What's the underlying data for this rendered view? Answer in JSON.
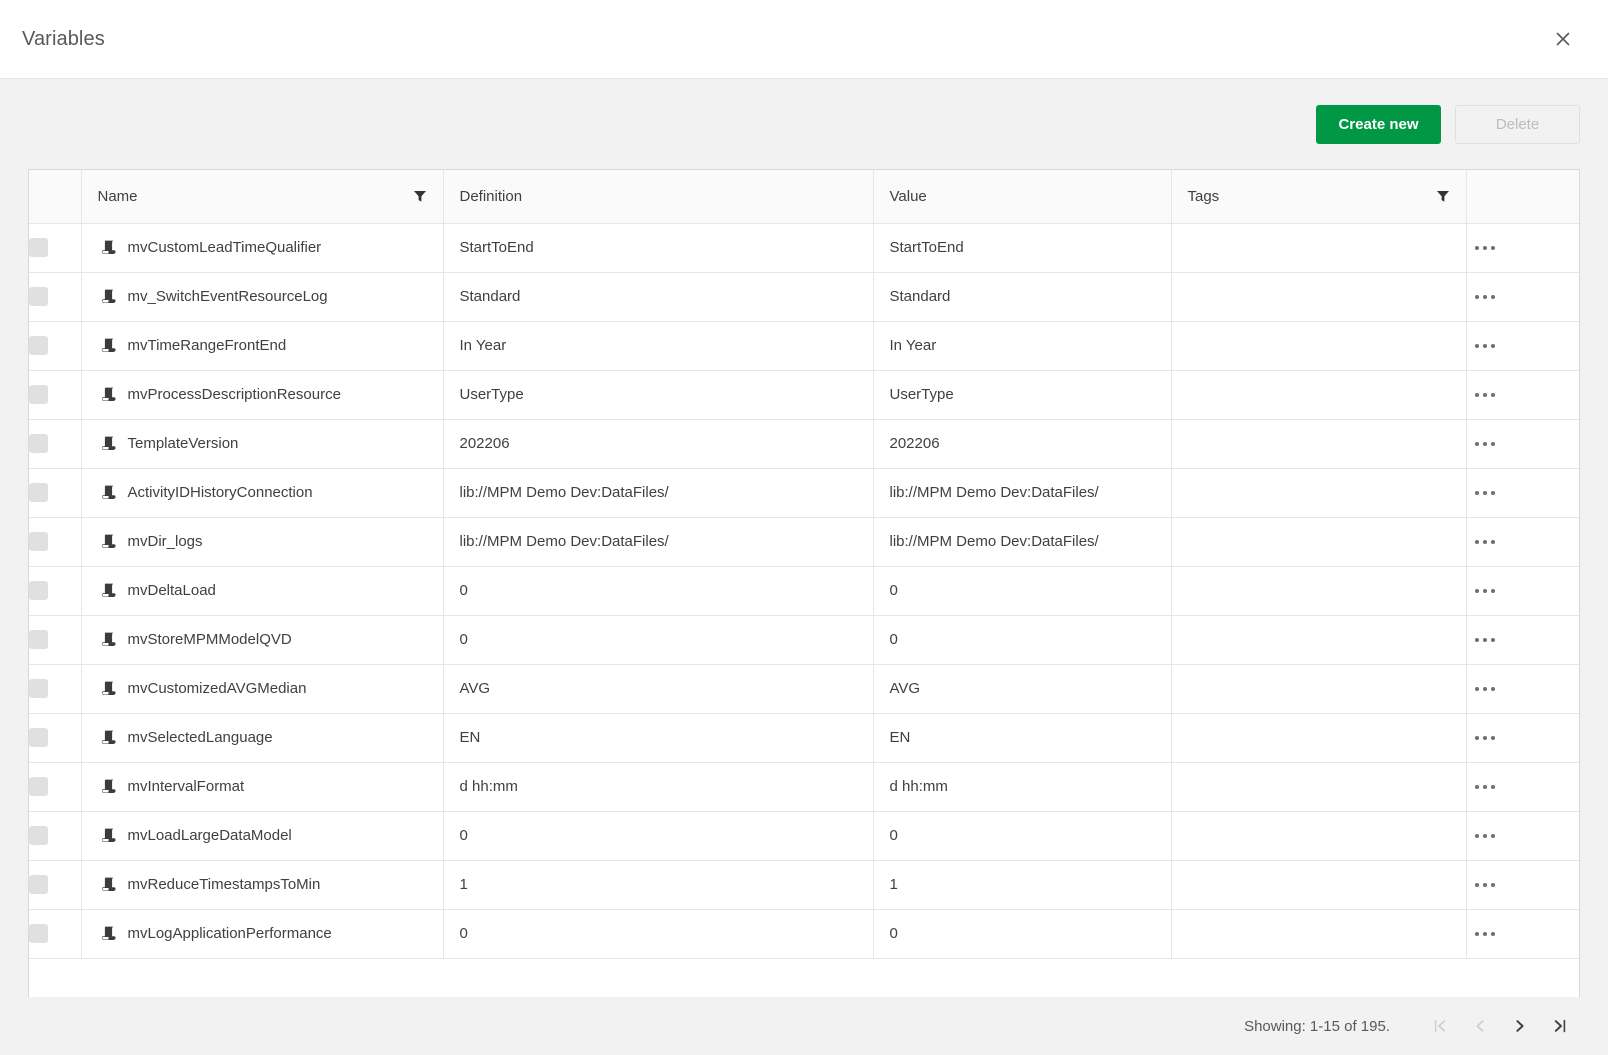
{
  "dialog": {
    "title": "Variables",
    "close_icon": "close-icon"
  },
  "toolbar": {
    "create_label": "Create new",
    "delete_label": "Delete",
    "primary_color": "#009845"
  },
  "table": {
    "columns": [
      {
        "key": "check",
        "label": "",
        "filter": false
      },
      {
        "key": "name",
        "label": "Name",
        "filter": true
      },
      {
        "key": "definition",
        "label": "Definition",
        "filter": false
      },
      {
        "key": "value",
        "label": "Value",
        "filter": false
      },
      {
        "key": "tags",
        "label": "Tags",
        "filter": true
      },
      {
        "key": "menu",
        "label": "",
        "filter": false
      }
    ],
    "row_icon": "variable-scroll-icon",
    "row_menu_icon": "kebab-menu-icon",
    "rows": [
      {
        "name": "mvCustomLeadTimeQualifier",
        "definition": "StartToEnd",
        "value": "StartToEnd",
        "tags": ""
      },
      {
        "name": "mv_SwitchEventResourceLog",
        "definition": "Standard",
        "value": "Standard",
        "tags": ""
      },
      {
        "name": "mvTimeRangeFrontEnd",
        "definition": "In Year",
        "value": "In Year",
        "tags": ""
      },
      {
        "name": "mvProcessDescriptionResource",
        "definition": "UserType",
        "value": "UserType",
        "tags": ""
      },
      {
        "name": "TemplateVersion",
        "definition": "202206",
        "value": "202206",
        "tags": ""
      },
      {
        "name": "ActivityIDHistoryConnection",
        "definition": "lib://MPM Demo Dev:DataFiles/",
        "value": "lib://MPM Demo Dev:DataFiles/",
        "tags": ""
      },
      {
        "name": "mvDir_logs",
        "definition": "lib://MPM Demo Dev:DataFiles/",
        "value": "lib://MPM Demo Dev:DataFiles/",
        "tags": ""
      },
      {
        "name": "mvDeltaLoad",
        "definition": "0",
        "value": "0",
        "tags": ""
      },
      {
        "name": "mvStoreMPMModelQVD",
        "definition": "0",
        "value": "0",
        "tags": ""
      },
      {
        "name": "mvCustomizedAVGMedian",
        "definition": "AVG",
        "value": "AVG",
        "tags": ""
      },
      {
        "name": "mvSelectedLanguage",
        "definition": "EN",
        "value": "EN",
        "tags": ""
      },
      {
        "name": "mvIntervalFormat",
        "definition": "d hh:mm",
        "value": "d hh:mm",
        "tags": ""
      },
      {
        "name": "mvLoadLargeDataModel",
        "definition": "0",
        "value": "0",
        "tags": ""
      },
      {
        "name": "mvReduceTimestampsToMin",
        "definition": "1",
        "value": "1",
        "tags": ""
      },
      {
        "name": "mvLogApplicationPerformance",
        "definition": "0",
        "value": "0",
        "tags": ""
      }
    ]
  },
  "footer": {
    "showing": "Showing: 1-15 of 195.",
    "pager": [
      {
        "name": "first-page-button",
        "glyph": "|<",
        "enabled": false
      },
      {
        "name": "previous-page-button",
        "glyph": "<",
        "enabled": false
      },
      {
        "name": "next-page-button",
        "glyph": ">",
        "enabled": true
      },
      {
        "name": "last-page-button",
        "glyph": ">|",
        "enabled": true
      }
    ]
  }
}
